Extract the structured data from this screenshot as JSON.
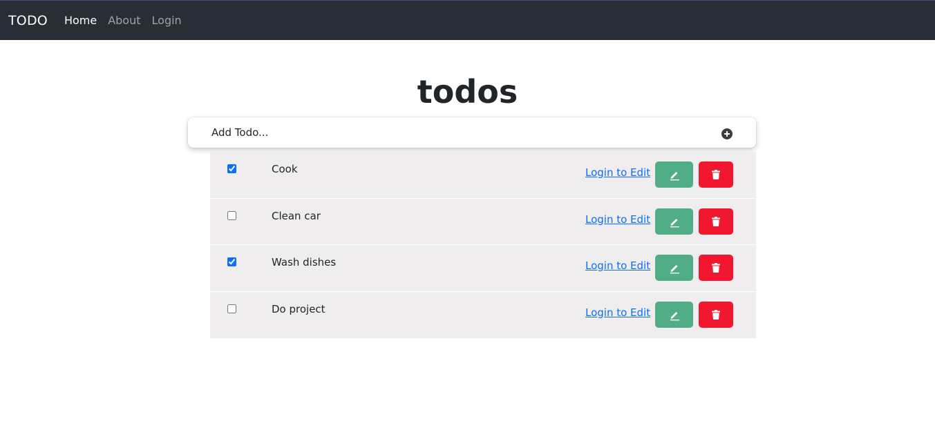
{
  "navbar": {
    "brand": "TODO",
    "links": [
      {
        "label": "Home",
        "active": true
      },
      {
        "label": "About",
        "active": false
      },
      {
        "label": "Login",
        "active": false
      }
    ]
  },
  "main": {
    "title": "todos",
    "add_todo": {
      "placeholder": "Add Todo...",
      "value": "",
      "button_icon": "plus-circle-icon"
    },
    "todos": [
      {
        "text": "Cook",
        "checked": true,
        "edit_link": "Login to Edit",
        "edit_icon": "pencil-icon",
        "delete_icon": "trash-icon"
      },
      {
        "text": "Clean car",
        "checked": false,
        "edit_link": "Login to Edit",
        "edit_icon": "pencil-icon",
        "delete_icon": "trash-icon"
      },
      {
        "text": "Wash dishes",
        "checked": true,
        "edit_link": "Login to Edit",
        "edit_icon": "pencil-icon",
        "delete_icon": "trash-icon"
      },
      {
        "text": "Do project",
        "checked": false,
        "edit_link": "Login to Edit",
        "edit_icon": "pencil-icon",
        "delete_icon": "trash-icon"
      }
    ]
  },
  "colors": {
    "navbar_bg": "#272e35",
    "edit_button": "#50ad86",
    "delete_button": "#f0172f",
    "link": "#0d6efd",
    "list_bg": "#efeded"
  }
}
